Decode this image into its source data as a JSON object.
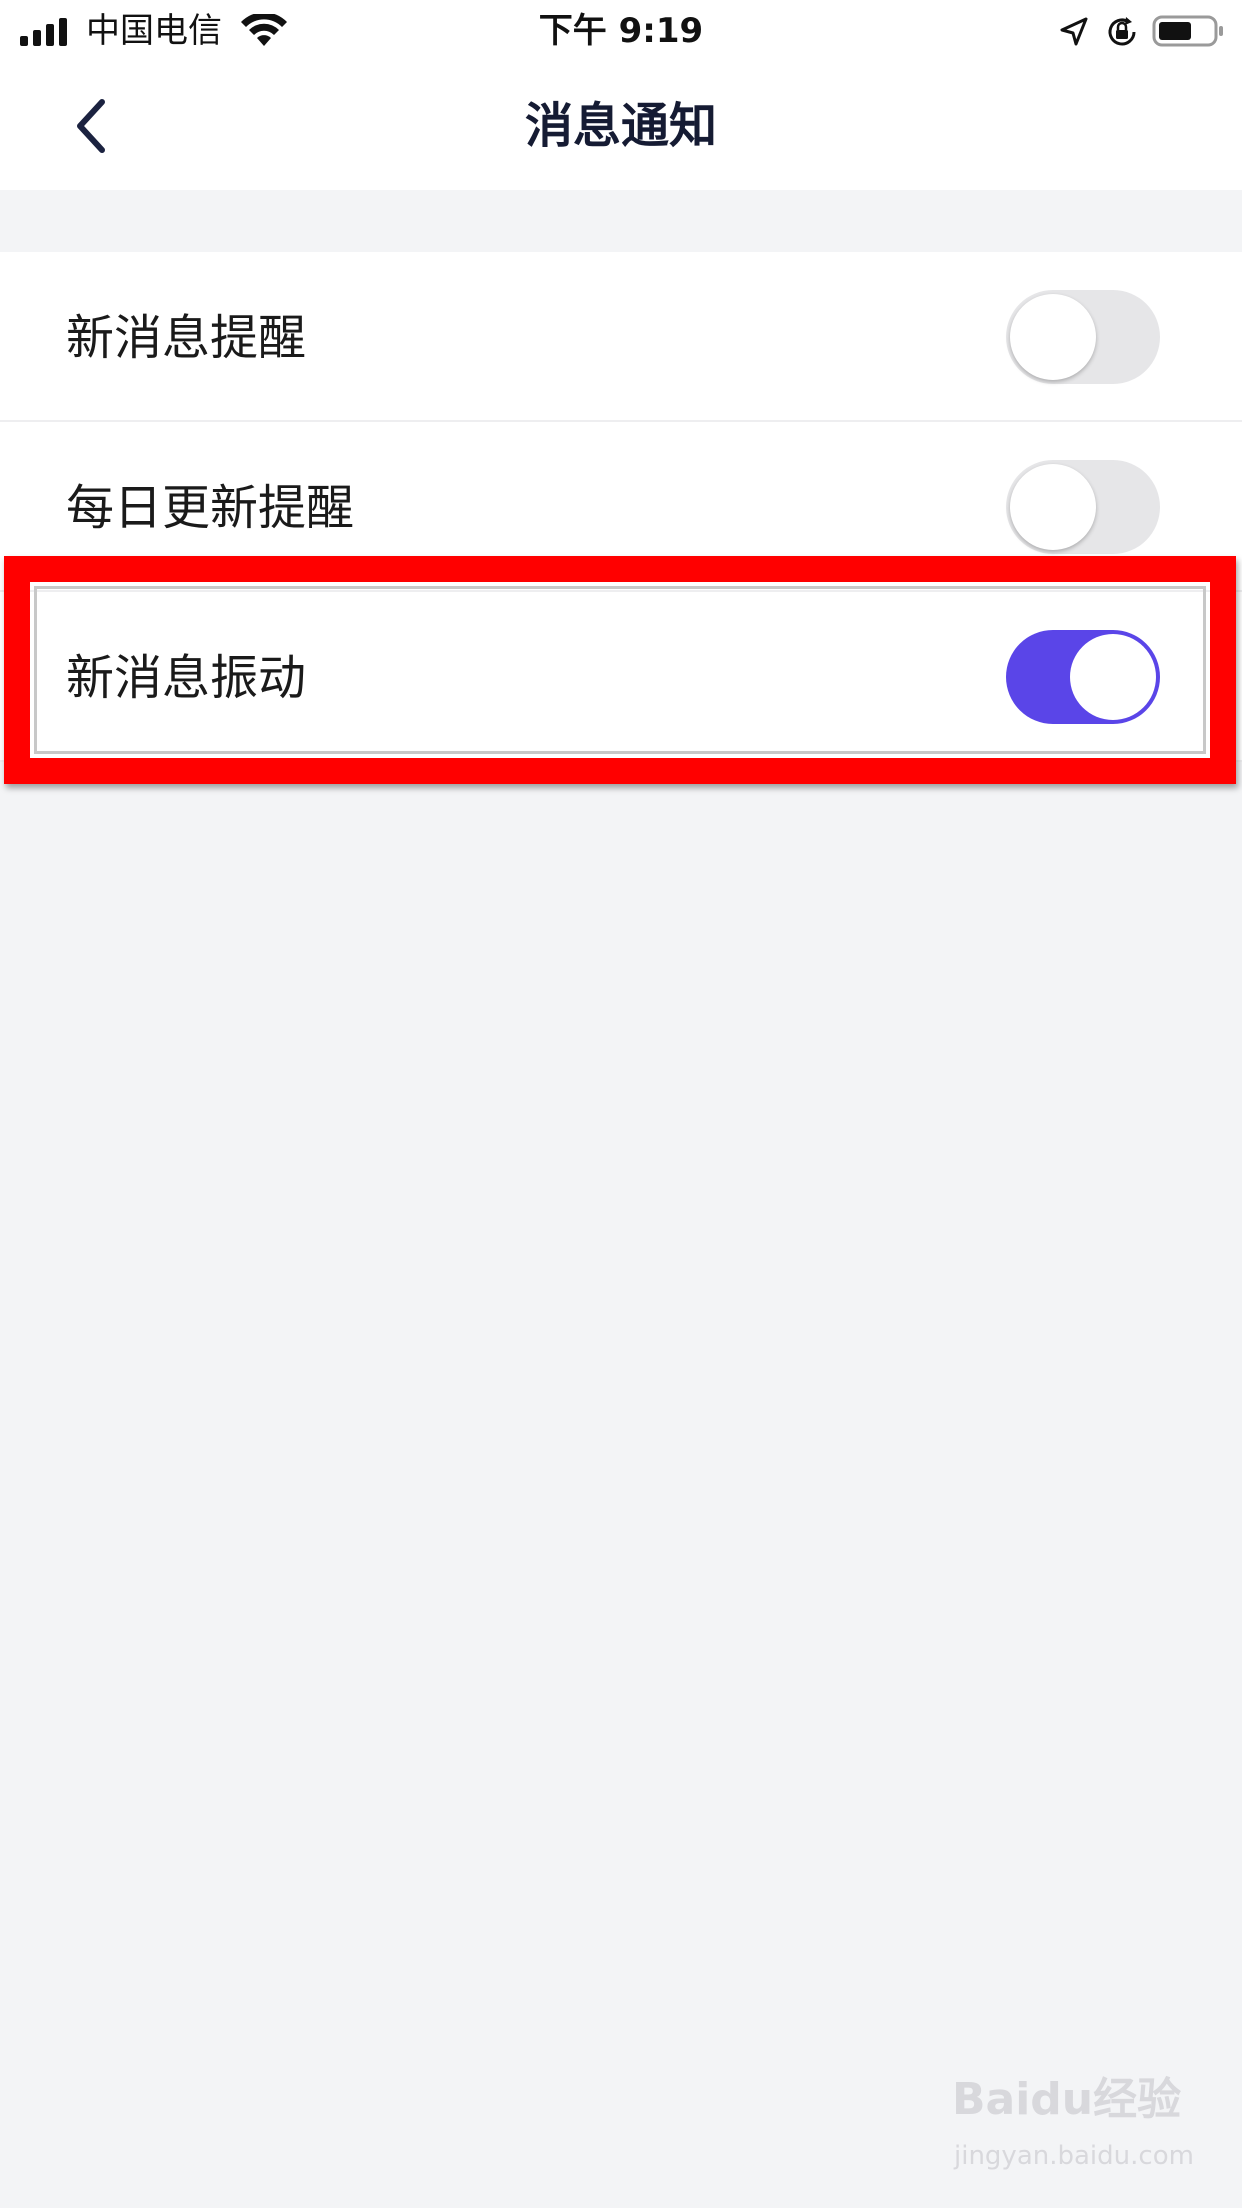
{
  "status_bar": {
    "carrier": "中国电信",
    "time": "下午 9:19"
  },
  "nav": {
    "title": "消息通知"
  },
  "settings": {
    "items": [
      {
        "label": "新消息提醒",
        "enabled": false
      },
      {
        "label": "每日更新提醒",
        "enabled": false
      },
      {
        "label": "新消息振动",
        "enabled": true
      }
    ]
  },
  "colors": {
    "toggle_on": "#5a45e8",
    "toggle_off": "#e6e6e8",
    "highlight": "#ff0000",
    "page_background": "#f3f4f6"
  },
  "watermark": {
    "brand": "Baidu经验",
    "url": "jingyan.baidu.com"
  }
}
